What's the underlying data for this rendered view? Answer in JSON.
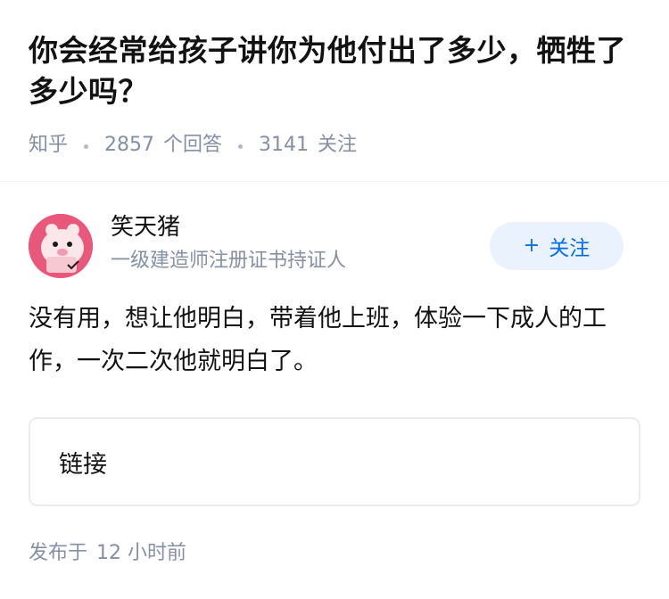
{
  "question": {
    "title": "你会经常给孩子讲你为他付出了多少，牺牲了多少吗？",
    "source": "知乎",
    "answer_count": "2857",
    "answer_unit": "个回答",
    "follower_count": "3141",
    "follower_unit": "关注"
  },
  "answer": {
    "author": {
      "name": "笑天猪",
      "bio": "一级建造师注册证书持证人",
      "avatar_icon": "cartoon-pig-avatar"
    },
    "follow_button": {
      "plus": "+",
      "label": "关注"
    },
    "content": "没有用，想让他明白，带着他上班，体验一下成人的工作，一次二次他就明白了。",
    "link_card": {
      "label": "链接"
    },
    "published": {
      "prefix": "发布于",
      "time": "12 小时前"
    }
  },
  "colors": {
    "accent": "#056de8",
    "follow_bg": "#eaf2fd",
    "meta_gray": "#8590a6",
    "avatar_bg": "#e9577a"
  }
}
